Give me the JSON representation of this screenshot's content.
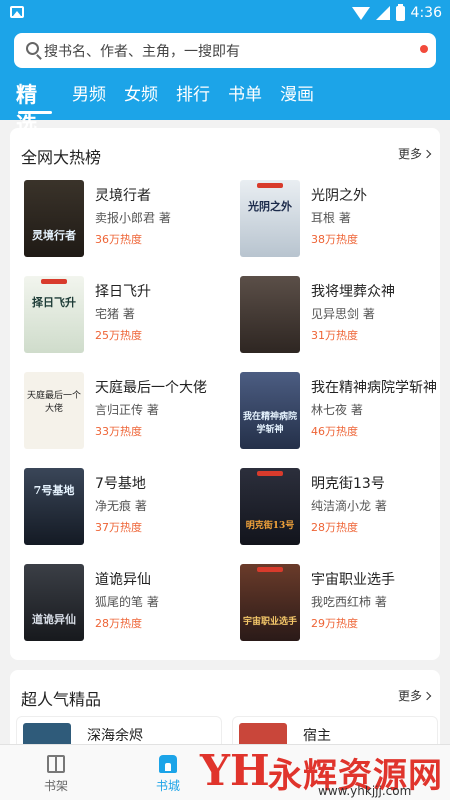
{
  "status": {
    "time": "4:36"
  },
  "search": {
    "placeholder": "搜书名、作者、主角，一搜即有"
  },
  "tabs": [
    "精选",
    "男频",
    "女频",
    "排行",
    "书单",
    "漫画"
  ],
  "hot": {
    "title": "全网大热榜",
    "more": "更多",
    "books": [
      {
        "name": "灵境行者",
        "author": "卖报小郎君 著",
        "heat": "36万热度",
        "cover_text": "灵境行者",
        "cover_color": "#2b2621"
      },
      {
        "name": "光阴之外",
        "author": "耳根 著",
        "heat": "38万热度",
        "cover_text": "光阴之外",
        "cover_color": "#cfd8e0"
      },
      {
        "name": "择日飞升",
        "author": "宅猪 著",
        "heat": "25万热度",
        "cover_text": "择日飞升",
        "cover_color": "#dfe9df"
      },
      {
        "name": "我将埋葬众神",
        "author": "见异思剑 著",
        "heat": "31万热度",
        "cover_text": "",
        "cover_color": "#4a3f3a"
      },
      {
        "name": "天庭最后一个大佬",
        "author": "言归正传 著",
        "heat": "33万热度",
        "cover_text": "天庭最后一个大佬",
        "cover_color": "#f4f1ea"
      },
      {
        "name": "我在精神病院学斩神",
        "author": "林七夜 著",
        "heat": "46万热度",
        "cover_text": "我在精神病院学斩神",
        "cover_color": "#3b4a6a"
      },
      {
        "name": "7号基地",
        "author": "净无痕 著",
        "heat": "37万热度",
        "cover_text": "7号基地",
        "cover_color": "#1d2430"
      },
      {
        "name": "明克街13号",
        "author": "纯洁滴小龙 著",
        "heat": "28万热度",
        "cover_text": "明克街13号",
        "cover_color": "#1b1f2c"
      },
      {
        "name": "道诡异仙",
        "author": "狐尾的笔 著",
        "heat": "28万热度",
        "cover_text": "道诡异仙",
        "cover_color": "#25272c"
      },
      {
        "name": "宇宙职业选手",
        "author": "我吃西红柿 著",
        "heat": "29万热度",
        "cover_text": "宇宙职业选手",
        "cover_color": "#3a2a24"
      }
    ]
  },
  "popular": {
    "title": "超人气精品",
    "more": "更多",
    "books": [
      {
        "name": "深海余烬"
      },
      {
        "name": "宿主"
      }
    ]
  },
  "bottom_nav": [
    {
      "label": "书架",
      "icon": "bookshelf-icon"
    },
    {
      "label": "书城",
      "icon": "bookstore-icon"
    }
  ],
  "watermark": {
    "logo": "YH",
    "name": "永辉资源网",
    "url": "www.yhkjjj.com"
  }
}
